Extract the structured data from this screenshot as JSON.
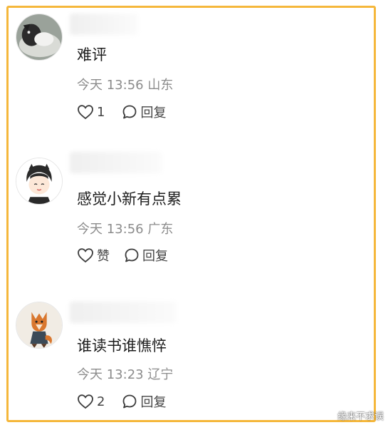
{
  "comments": [
    {
      "text": "难评",
      "time": "今天 13:56",
      "location": "山东",
      "like_label": "1",
      "reply_label": "回复"
    },
    {
      "text": "感觉小新有点累",
      "time": "今天 13:56",
      "location": "广东",
      "like_label": "赞",
      "reply_label": "回复"
    },
    {
      "text": "谁读书谁憔悴",
      "time": "今天 13:23",
      "location": "辽宁",
      "like_label": "2",
      "reply_label": "回复"
    }
  ],
  "watermark": "缘来不求误",
  "colors": {
    "frame_border": "#f5b73b",
    "text": "#1d1d1d",
    "meta": "#8c8c8c",
    "action": "#444444"
  },
  "icons": {
    "like": "heart-outline-icon",
    "reply": "speech-bubble-icon"
  }
}
